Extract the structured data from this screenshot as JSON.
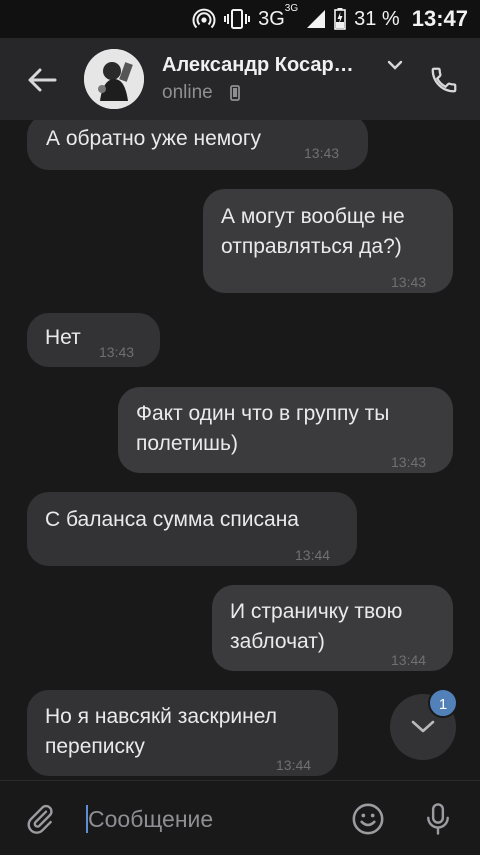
{
  "status_bar": {
    "network": "3G",
    "network_sup": "3G",
    "battery": "31 %",
    "time": "13:47"
  },
  "header": {
    "contact_name": "Александр Косар…",
    "status": "online"
  },
  "messages": [
    {
      "direction": "in",
      "lines": [
        "А обратно уже немогу"
      ],
      "time": "13:43"
    },
    {
      "direction": "out",
      "lines": [
        "А могут вообще не",
        "отправляться да?)"
      ],
      "time": "13:43"
    },
    {
      "direction": "in",
      "lines": [
        "Нет"
      ],
      "time": "13:43"
    },
    {
      "direction": "out",
      "lines": [
        "Факт один что в группу ты",
        "полетишь)"
      ],
      "time": "13:43"
    },
    {
      "direction": "in",
      "lines": [
        "С баланса сумма списана"
      ],
      "time": "13:44"
    },
    {
      "direction": "out",
      "lines": [
        "И страничку твою",
        "заблочат)"
      ],
      "time": "13:44"
    },
    {
      "direction": "in",
      "lines": [
        "Но я навсякй заскринел",
        "переписку"
      ],
      "time": "13:44"
    }
  ],
  "scroll_fab": {
    "unread_count": "1"
  },
  "composer": {
    "placeholder": "Сообщение"
  },
  "icons": {
    "back": "arrow-left-icon",
    "phone": "phone-icon",
    "attach": "paperclip-icon",
    "emoji": "emoji-icon",
    "mic": "microphone-icon",
    "scroll_down": "chevron-down-icon"
  },
  "colors": {
    "background": "#19191a",
    "header": "#272729",
    "bubble_in": "#333336",
    "bubble_out": "#3b3b3e",
    "accent": "#5181b8"
  }
}
